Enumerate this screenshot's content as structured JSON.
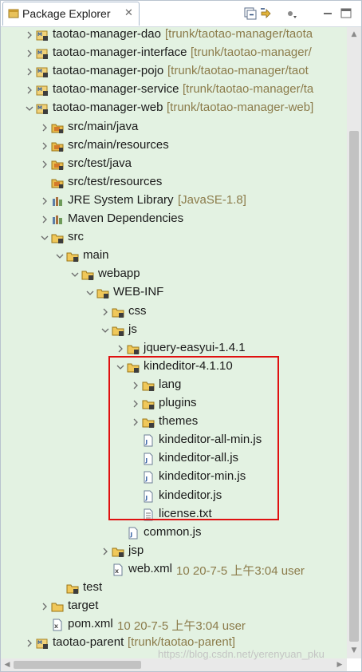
{
  "view": {
    "title": "Package Explorer"
  },
  "toolbar": {
    "icons": [
      "collapse-all-icon",
      "link-with-editor-icon",
      "view-menu-icon",
      "minimize-icon",
      "maximize-icon"
    ]
  },
  "tree": [
    {
      "label": "taotao-manager-dao",
      "decoration": "[trunk/taotao-manager/taota"
    },
    {
      "label": "taotao-manager-interface",
      "decoration": "[trunk/taotao-manager/"
    },
    {
      "label": "taotao-manager-pojo",
      "decoration": "[trunk/taotao-manager/taot"
    },
    {
      "label": "taotao-manager-service",
      "decoration": "[trunk/taotao-manager/ta"
    },
    {
      "label": "taotao-manager-web",
      "decoration": "[trunk/taotao-manager-web]"
    },
    {
      "label": "src/main/java",
      "decoration": ""
    },
    {
      "label": "src/main/resources",
      "decoration": ""
    },
    {
      "label": "src/test/java",
      "decoration": ""
    },
    {
      "label": "src/test/resources",
      "decoration": ""
    },
    {
      "label": "JRE System Library",
      "decoration": "[JavaSE-1.8]"
    },
    {
      "label": "Maven Dependencies",
      "decoration": ""
    },
    {
      "label": "src",
      "decoration": ""
    },
    {
      "label": "main",
      "decoration": ""
    },
    {
      "label": "webapp",
      "decoration": ""
    },
    {
      "label": "WEB-INF",
      "decoration": ""
    },
    {
      "label": "css",
      "decoration": ""
    },
    {
      "label": "js",
      "decoration": ""
    },
    {
      "label": "jquery-easyui-1.4.1",
      "decoration": ""
    },
    {
      "label": "kindeditor-4.1.10",
      "decoration": ""
    },
    {
      "label": "lang",
      "decoration": ""
    },
    {
      "label": "plugins",
      "decoration": ""
    },
    {
      "label": "themes",
      "decoration": ""
    },
    {
      "label": "kindeditor-all-min.js",
      "decoration": ""
    },
    {
      "label": "kindeditor-all.js",
      "decoration": ""
    },
    {
      "label": "kindeditor-min.js",
      "decoration": ""
    },
    {
      "label": "kindeditor.js",
      "decoration": ""
    },
    {
      "label": "license.txt",
      "decoration": ""
    },
    {
      "label": "common.js",
      "decoration": ""
    },
    {
      "label": "jsp",
      "decoration": ""
    },
    {
      "label": "web.xml",
      "decoration": "10  20-7-5 上午3:04  user"
    },
    {
      "label": "test",
      "decoration": ""
    },
    {
      "label": "target",
      "decoration": ""
    },
    {
      "label": "pom.xml",
      "decoration": "10  20-7-5 上午3:04  user"
    },
    {
      "label": "taotao-parent",
      "decoration": "[trunk/taotao-parent]"
    }
  ],
  "watermark": "https://blog.csdn.net/yerenyuan_pku",
  "colors": {
    "tree_background": "#e3f2e2",
    "highlight_border": "#e01010",
    "decoration_text": "#8b7b4a"
  }
}
